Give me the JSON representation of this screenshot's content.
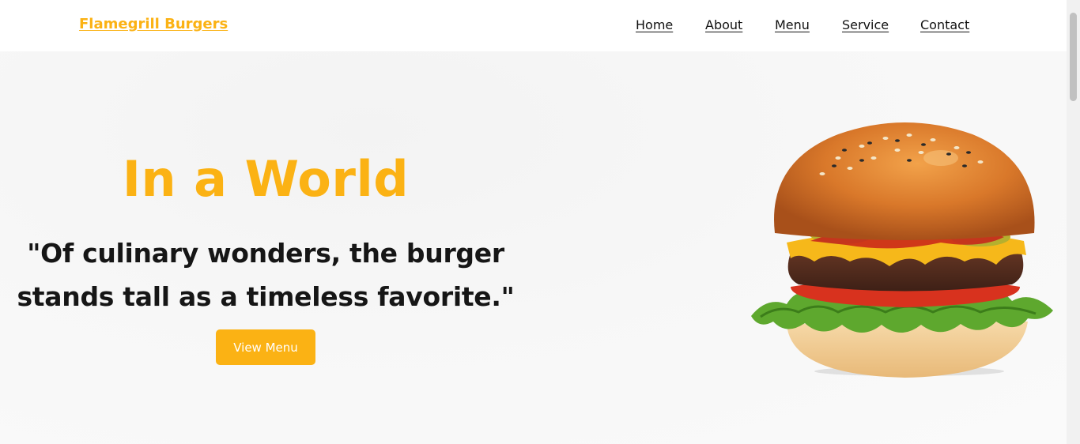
{
  "brand": {
    "name": "Flamegrill Burgers",
    "color": "#FBB214"
  },
  "nav": {
    "items": [
      {
        "label": "Home"
      },
      {
        "label": "About"
      },
      {
        "label": "Menu"
      },
      {
        "label": "Service"
      },
      {
        "label": "Contact"
      }
    ]
  },
  "hero": {
    "title": "In a World",
    "quote": "\"Of culinary wonders, the burger stands tall as a timeless favorite.\"",
    "button_label": "View Menu",
    "image": "burger-image"
  },
  "colors": {
    "accent": "#FBB214",
    "text": "#161616",
    "background": "#F8F8F8"
  }
}
